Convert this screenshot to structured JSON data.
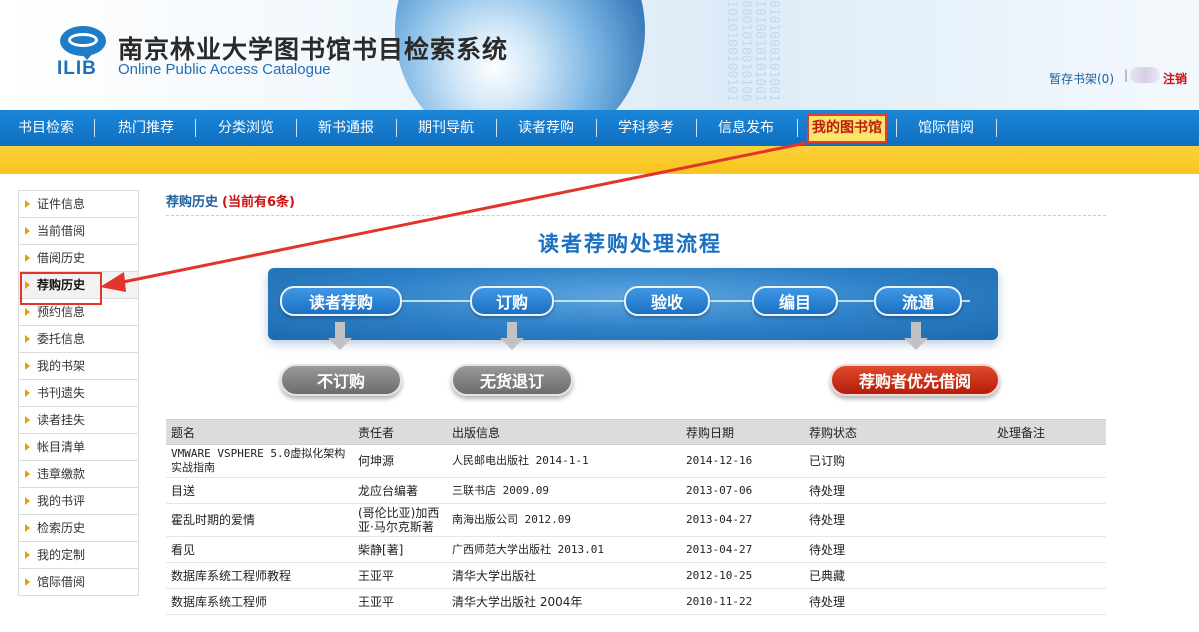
{
  "header": {
    "logo_text": "ILIB",
    "title": "南京林业大学图书馆书目检索系统",
    "subtitle": "Online Public Access Catalogue",
    "binary_deco": "0101000101001 1010010101001 0001010010100 1010100100101",
    "cart_label": "暂存书架(0)",
    "separator": "|",
    "logout_label": "注销"
  },
  "nav": {
    "items": [
      "书目检索",
      "热门推荐",
      "分类浏览",
      "新书通报",
      "期刊导航",
      "读者荐购",
      "学科参考",
      "信息发布",
      "我的图书馆",
      "馆际借阅"
    ],
    "active": "我的图书馆"
  },
  "sidebar": {
    "items": [
      "证件信息",
      "当前借阅",
      "借阅历史",
      "荐购历史",
      "预约信息",
      "委托信息",
      "我的书架",
      "书刊遗失",
      "读者挂失",
      "帐目清单",
      "违章缴款",
      "我的书评",
      "检索历史",
      "我的定制",
      "馆际借阅"
    ],
    "active": "荐购历史"
  },
  "main": {
    "title": "荐购历史",
    "count_text": "(当前有6条)",
    "flow": {
      "title": "读者荐购处理流程",
      "steps": [
        "读者荐购",
        "订购",
        "验收",
        "编目",
        "流通"
      ],
      "outcomes": [
        "不订购",
        "无货退订",
        "荐购者优先借阅"
      ]
    }
  },
  "table": {
    "headers": [
      "题名",
      "责任者",
      "出版信息",
      "荐购日期",
      "荐购状态",
      "处理备注"
    ],
    "rows": [
      {
        "title": "VMWARE VSPHERE 5.0虚拟化架构实战指南",
        "author": "何坤源",
        "publisher": "人民邮电出版社 2014-1-1",
        "date": "2014-12-16",
        "status": "已订购",
        "note": ""
      },
      {
        "title": "目送",
        "author": "龙应台编著",
        "publisher": "三联书店 2009.09",
        "date": "2013-07-06",
        "status": "待处理",
        "note": ""
      },
      {
        "title": "霍乱时期的爱情",
        "author": "(哥伦比亚)加西亚·马尔克斯著",
        "publisher": "南海出版公司 2012.09",
        "date": "2013-04-27",
        "status": "待处理",
        "note": ""
      },
      {
        "title": "看见",
        "author": "柴静[著]",
        "publisher": "广西师范大学出版社 2013.01",
        "date": "2013-04-27",
        "status": "待处理",
        "note": ""
      },
      {
        "title": "数据库系统工程师教程",
        "author": "王亚平",
        "publisher": "清华大学出版社",
        "date": "2012-10-25",
        "status": "已典藏",
        "note": ""
      },
      {
        "title": "数据库系统工程师",
        "author": "王亚平",
        "publisher": "清华大学出版社 2004年",
        "date": "2010-11-22",
        "status": "待处理",
        "note": ""
      }
    ]
  },
  "colors": {
    "nav_blue": "#1278c8",
    "band_yellow": "#fbcb2d",
    "annotation_red": "#e2342a",
    "status_green": "#1a9a1a",
    "link_blue": "#1f5f9f"
  }
}
